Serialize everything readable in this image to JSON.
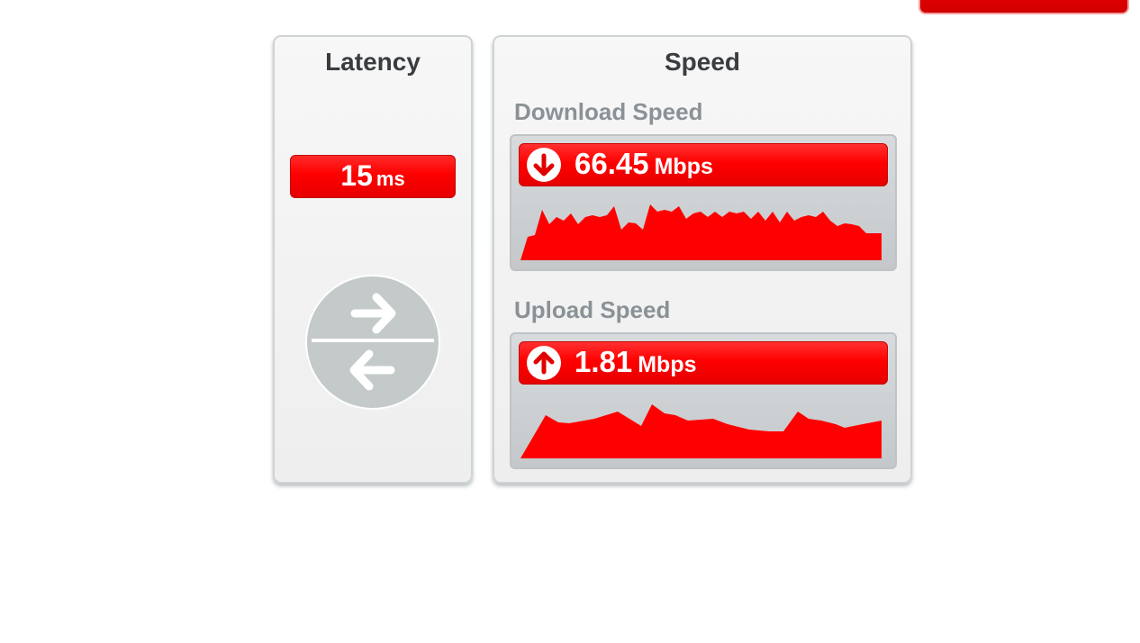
{
  "latency": {
    "title": "Latency",
    "value": "15",
    "unit": "ms"
  },
  "speed": {
    "title": "Speed",
    "download": {
      "label": "Download Speed",
      "value": "66.45",
      "unit": "Mbps",
      "icon": "arrow-down-icon"
    },
    "upload": {
      "label": "Upload Speed",
      "value": "1.81",
      "unit": "Mbps",
      "icon": "arrow-up-icon"
    }
  },
  "colors": {
    "accent_red": "#ff0000",
    "title_text": "#3a3d40",
    "label_text": "#8a9297",
    "icon_gray": "#c4c9ca"
  }
}
